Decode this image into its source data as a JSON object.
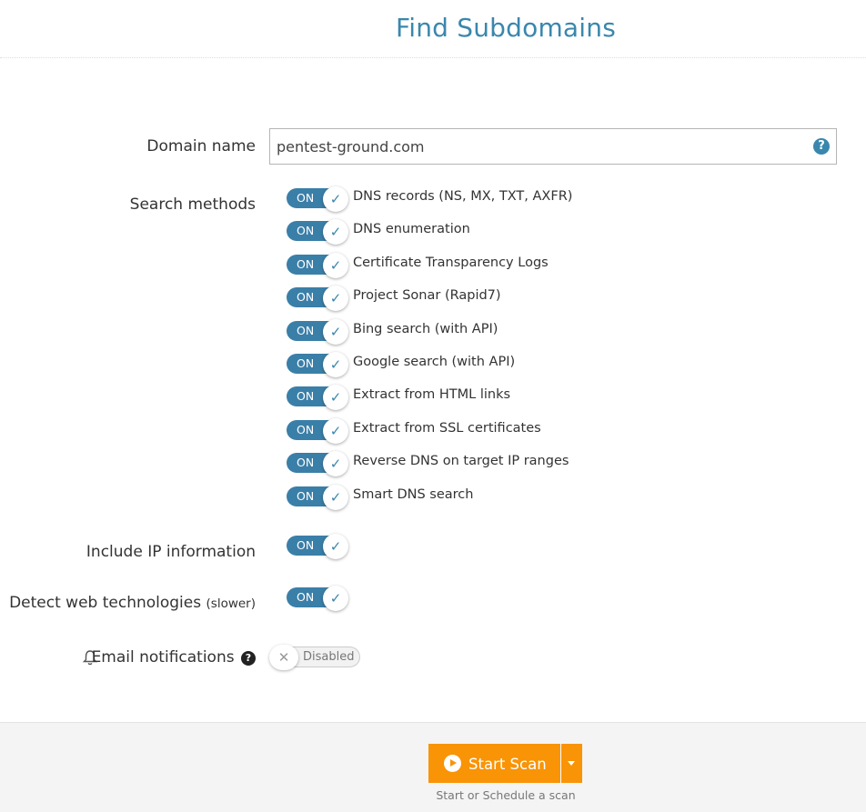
{
  "header": {
    "title": "Find Subdomains"
  },
  "form": {
    "domain": {
      "label": "Domain name",
      "value": "pentest-ground.com",
      "help_icon": "question-circle-icon"
    },
    "search_methods": {
      "label": "Search methods",
      "items": [
        {
          "label": "DNS records (NS, MX, TXT, AXFR)",
          "state": "ON"
        },
        {
          "label": "DNS enumeration",
          "state": "ON"
        },
        {
          "label": "Certificate Transparency Logs",
          "state": "ON"
        },
        {
          "label": "Project Sonar (Rapid7)",
          "state": "ON"
        },
        {
          "label": "Bing search (with API)",
          "state": "ON"
        },
        {
          "label": "Google search (with API)",
          "state": "ON"
        },
        {
          "label": "Extract from HTML links",
          "state": "ON"
        },
        {
          "label": "Extract from SSL certificates",
          "state": "ON"
        },
        {
          "label": "Reverse DNS on target IP ranges",
          "state": "ON"
        },
        {
          "label": "Smart DNS search",
          "state": "ON"
        }
      ]
    },
    "include_ip": {
      "label": "Include IP information",
      "state": "ON"
    },
    "detect_web": {
      "label": "Detect web technologies",
      "note": "(slower)",
      "state": "ON"
    },
    "email": {
      "label": "Email notifications",
      "state": "Disabled",
      "bell_icon": "bell-icon",
      "help_icon": "question-circle-icon"
    }
  },
  "footer": {
    "start_label": "Start Scan",
    "hint": "Start or Schedule a scan"
  },
  "colors": {
    "accent": "#3a87ad",
    "toggle_on": "#3a7fa8",
    "primary_button": "#f89406"
  }
}
